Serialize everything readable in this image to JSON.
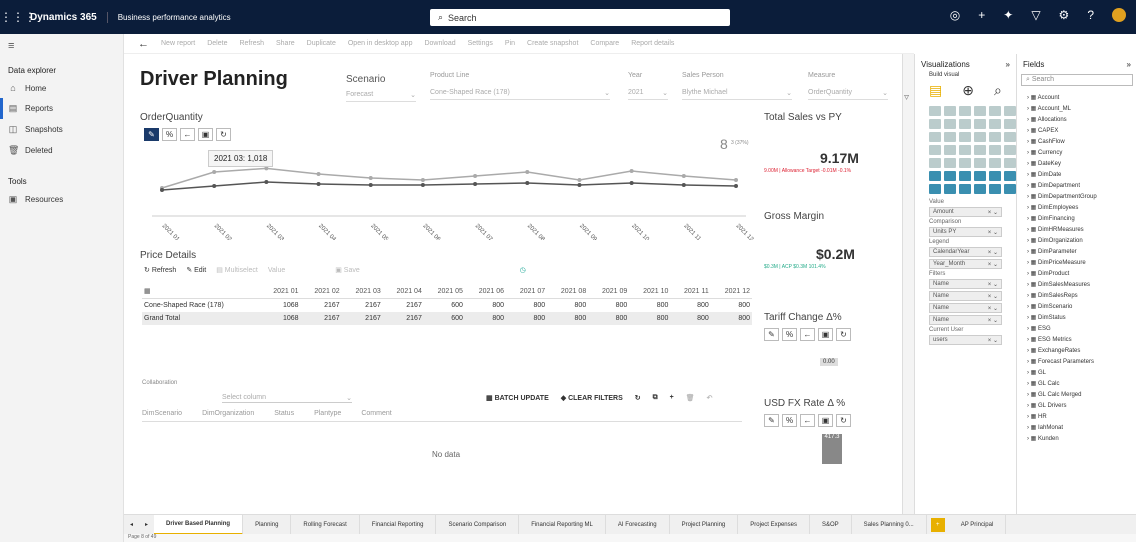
{
  "app": {
    "name": "Dynamics 365",
    "area": "Business performance analytics",
    "search_placeholder": "Search"
  },
  "nav": {
    "section1": "Data explorer",
    "items": [
      {
        "label": "Home",
        "icon": "home-icon"
      },
      {
        "label": "Reports",
        "icon": "reports-icon"
      },
      {
        "label": "Snapshots",
        "icon": "snapshots-icon"
      },
      {
        "label": "Deleted",
        "icon": "trash-icon"
      }
    ],
    "section2": "Tools",
    "tools": [
      {
        "label": "Resources",
        "icon": "resources-icon"
      }
    ]
  },
  "cmd": [
    "New report",
    "Delete",
    "Refresh",
    "Share",
    "Duplicate",
    "Open in desktop app",
    "Download",
    "Settings",
    "Pin",
    "Create snapshot",
    "Compare",
    "Report details"
  ],
  "report": {
    "title": "Driver Planning",
    "slicers": {
      "scenario_label": "Scenario",
      "scenario_value": "Forecast",
      "product_line_label": "Product Line",
      "product_line_value": "Cone-Shaped Race (178)",
      "year_label": "Year",
      "year_value": "2021",
      "sales_person_label": "Sales Person",
      "sales_person_value": "Blythe Michael",
      "measure_label": "Measure",
      "measure_value": "OrderQuantity"
    },
    "chart_title": "OrderQuantity",
    "chart_count": "8",
    "chart_count_note": "3 (37%)",
    "tooltip": "2021 03:  1,018",
    "price_title": "Price Details",
    "price_toolbar": {
      "refresh": "Refresh",
      "edit": "Edit",
      "allocation": "Multiselect",
      "value": "Value",
      "save": "Save"
    },
    "table": {
      "headers": [
        "",
        "2021 01",
        "2021 02",
        "2021 03",
        "2021 04",
        "2021 05",
        "2021 06",
        "2021 07",
        "2021 08",
        "2021 09",
        "2021 10",
        "2021 11",
        "2021 12"
      ],
      "rows": [
        [
          "Cone-Shaped Race (178)",
          "1068",
          "2167",
          "2167",
          "2167",
          "600",
          "800",
          "800",
          "800",
          "800",
          "800",
          "800",
          "800"
        ],
        [
          "Grand Total",
          "1068",
          "2167",
          "2167",
          "2167",
          "600",
          "800",
          "800",
          "800",
          "800",
          "800",
          "800",
          "800"
        ]
      ]
    },
    "collab": {
      "label": "Collaboration",
      "select_placeholder": "Select column",
      "batch": "BATCH UPDATE",
      "clear": "CLEAR FILTERS",
      "cols": [
        "DimScenario",
        "DimOrganization",
        "Status",
        "Plantype",
        "Comment"
      ],
      "empty": "No data"
    },
    "kpis": {
      "sales_title": "Total Sales vs PY",
      "sales_value": "9.17M",
      "sales_sub": "9.00M | Allowance Target -0.01M -0.1%",
      "margin_title": "Gross Margin",
      "margin_value": "$0.2M",
      "margin_sub": "$0.3M | ACP $0.3M 101.4%",
      "tariff_title": "Tariff Change  Δ%",
      "tariff_value": "0.00",
      "fx_title": "USD FX Rate Δ %",
      "fx_value": "417.3"
    }
  },
  "chart_data": {
    "type": "line",
    "categories": [
      "2021 01",
      "2021 02",
      "2021 03",
      "2021 04",
      "2021 05",
      "2021 06",
      "2021 07",
      "2021 08",
      "2021 09",
      "2021 10",
      "2021 11",
      "2021 12"
    ],
    "series": [
      {
        "name": "",
        "values": [
          920,
          1000,
          1018,
          990,
          970,
          960,
          980,
          1000,
          960,
          1005,
          980,
          960
        ]
      },
      {
        "name": "",
        "values": [
          910,
          930,
          950,
          940,
          935,
          935,
          940,
          945,
          935,
          945,
          935,
          930
        ]
      }
    ],
    "ylim": [
      800,
      1100
    ]
  },
  "visualizations": {
    "title": "Visualizations",
    "build": "Build visual",
    "wells": [
      {
        "label": "Value",
        "items": [
          "Amount"
        ]
      },
      {
        "label": "Comparison",
        "items": [
          "Units PY"
        ]
      },
      {
        "label": "Legend",
        "items": [
          "CalendarYear",
          "Year_Month"
        ]
      },
      {
        "label": "Filters",
        "items": [
          "Name",
          "Name",
          "Name",
          "Name"
        ]
      },
      {
        "label": "Current User",
        "items": [
          "users"
        ]
      }
    ]
  },
  "fields": {
    "title": "Fields",
    "search": "Search",
    "items": [
      "Account",
      "Account_ML",
      "Allocations",
      "CAPEX",
      "CashFlow",
      "Currency",
      "DateKey",
      "DimDate",
      "DimDepartment",
      "DimDepartmentGroup",
      "DimEmployees",
      "DimFinancing",
      "DimHRMeasures",
      "DimOrganization",
      "DimParameter",
      "DimPriceMeasure",
      "DimProduct",
      "DimSalesMeasures",
      "DimSalesReps",
      "DimScenario",
      "DimStatus",
      "ESG",
      "ESG Metrics",
      "ExchangeRates",
      "Forecast Parameters",
      "GL",
      "GL Calc",
      "GL Calc Merged",
      "GL Drivers",
      "HR",
      "IahMonat",
      "Kunden"
    ]
  },
  "tabs": [
    "Driver Based Planning",
    "Planning",
    "Rolling Forecast",
    "Financial Reporting",
    "Scenario Comparison",
    "Financial Reporting ML",
    "AI Forecasting",
    "Project Planning",
    "Project Expenses",
    "S&OP",
    "Sales Planning 0...",
    "AP Principal"
  ],
  "status": "Page 8 of 49"
}
